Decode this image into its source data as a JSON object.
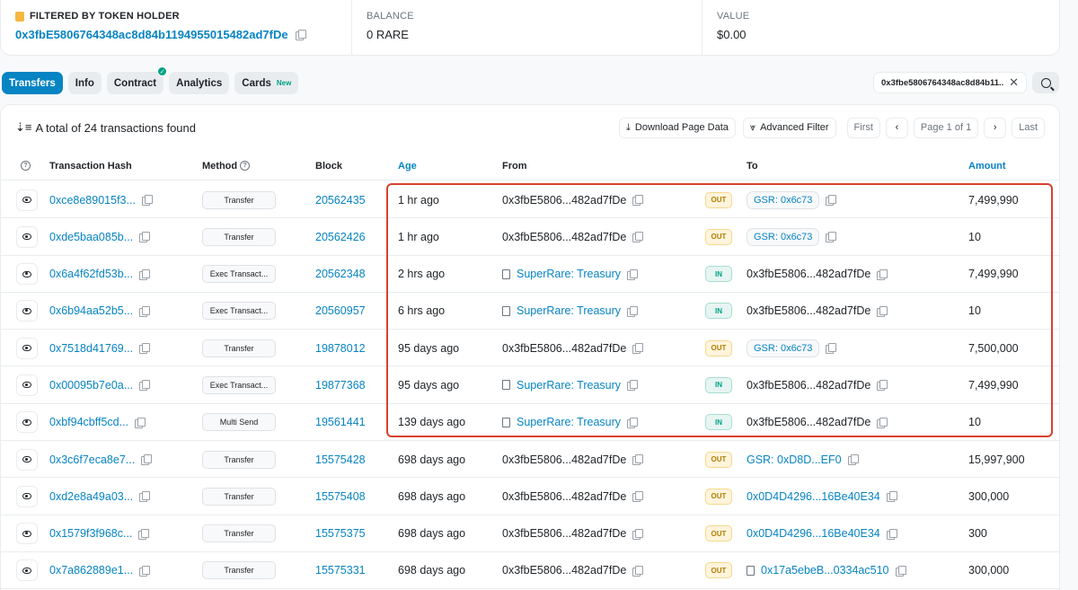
{
  "summary": {
    "filter_label": "FILTERED BY TOKEN HOLDER",
    "holder_address": "0x3fbE5806764348ac8d84b1194955015482ad7fDe",
    "balance_label": "BALANCE",
    "balance_value": "0 RARE",
    "value_label": "VALUE",
    "value_value": "$0.00"
  },
  "tabs": [
    {
      "label": "Transfers",
      "active": true
    },
    {
      "label": "Info"
    },
    {
      "label": "Contract",
      "verified": true
    },
    {
      "label": "Analytics"
    },
    {
      "label": "Cards",
      "badge": "New"
    }
  ],
  "filter_chip": {
    "text": "0x3fbe5806764348ac8d84b11..."
  },
  "toolbar": {
    "total_text": "A total of 24 transactions found",
    "download_label": "Download Page Data",
    "advanced_filter_label": "Advanced Filter",
    "first_label": "First",
    "prev_label": "‹",
    "page_label": "Page 1 of 1",
    "next_label": "›",
    "last_label": "Last"
  },
  "columns": {
    "hash": "Transaction Hash",
    "method": "Method",
    "block": "Block",
    "age": "Age",
    "from": "From",
    "to": "To",
    "amount": "Amount"
  },
  "rows": [
    {
      "hash": "0xce8e89015f3...",
      "method": "Transfer",
      "block": "20562435",
      "age": "1 hr ago",
      "from": "0x3fbE5806...482ad7fDe",
      "from_link": false,
      "dir": "OUT",
      "to": "GSR: 0x6c73",
      "to_style": "pill",
      "amount": "7,499,990"
    },
    {
      "hash": "0xde5baa085b...",
      "method": "Transfer",
      "block": "20562426",
      "age": "1 hr ago",
      "from": "0x3fbE5806...482ad7fDe",
      "from_link": false,
      "dir": "OUT",
      "to": "GSR: 0x6c73",
      "to_style": "pill",
      "amount": "10"
    },
    {
      "hash": "0x6a4f62fd53b...",
      "method": "Exec Transact...",
      "block": "20562348",
      "age": "2 hrs ago",
      "from": "SuperRare: Treasury",
      "from_link": true,
      "dir": "IN",
      "to": "0x3fbE5806...482ad7fDe",
      "to_style": "plain",
      "amount": "7,499,990"
    },
    {
      "hash": "0x6b94aa52b5...",
      "method": "Exec Transact...",
      "block": "20560957",
      "age": "6 hrs ago",
      "from": "SuperRare: Treasury",
      "from_link": true,
      "dir": "IN",
      "to": "0x3fbE5806...482ad7fDe",
      "to_style": "plain",
      "amount": "10"
    },
    {
      "hash": "0x7518d41769...",
      "method": "Transfer",
      "block": "19878012",
      "age": "95 days ago",
      "from": "0x3fbE5806...482ad7fDe",
      "from_link": false,
      "dir": "OUT",
      "to": "GSR: 0x6c73",
      "to_style": "pill",
      "amount": "7,500,000"
    },
    {
      "hash": "0x00095b7e0a...",
      "method": "Exec Transact...",
      "block": "19877368",
      "age": "95 days ago",
      "from": "SuperRare: Treasury",
      "from_link": true,
      "dir": "IN",
      "to": "0x3fbE5806...482ad7fDe",
      "to_style": "plain",
      "amount": "7,499,990"
    },
    {
      "hash": "0xbf94cbff5cd...",
      "method": "Multi Send",
      "block": "19561441",
      "age": "139 days ago",
      "from": "SuperRare: Treasury",
      "from_link": true,
      "dir": "IN",
      "to": "0x3fbE5806...482ad7fDe",
      "to_style": "plain",
      "amount": "10"
    },
    {
      "hash": "0x3c6f7eca8e7...",
      "method": "Transfer",
      "block": "15575428",
      "age": "698 days ago",
      "from": "0x3fbE5806...482ad7fDe",
      "from_link": false,
      "dir": "OUT",
      "to": "GSR: 0xD8D...EF0",
      "to_style": "link",
      "amount": "15,997,900"
    },
    {
      "hash": "0xd2e8a49a03...",
      "method": "Transfer",
      "block": "15575408",
      "age": "698 days ago",
      "from": "0x3fbE5806...482ad7fDe",
      "from_link": false,
      "dir": "OUT",
      "to": "0x0D4D4296...16Be40E34",
      "to_style": "link",
      "amount": "300,000"
    },
    {
      "hash": "0x1579f3f968c...",
      "method": "Transfer",
      "block": "15575375",
      "age": "698 days ago",
      "from": "0x3fbE5806...482ad7fDe",
      "from_link": false,
      "dir": "OUT",
      "to": "0x0D4D4296...16Be40E34",
      "to_style": "link",
      "amount": "300"
    },
    {
      "hash": "0x7a862889e1...",
      "method": "Transfer",
      "block": "15575331",
      "age": "698 days ago",
      "from": "0x3fbE5806...482ad7fDe",
      "from_link": false,
      "dir": "OUT",
      "to": "0x17a5ebeB...0334ac510",
      "to_style": "doclink",
      "amount": "300,000"
    }
  ]
}
